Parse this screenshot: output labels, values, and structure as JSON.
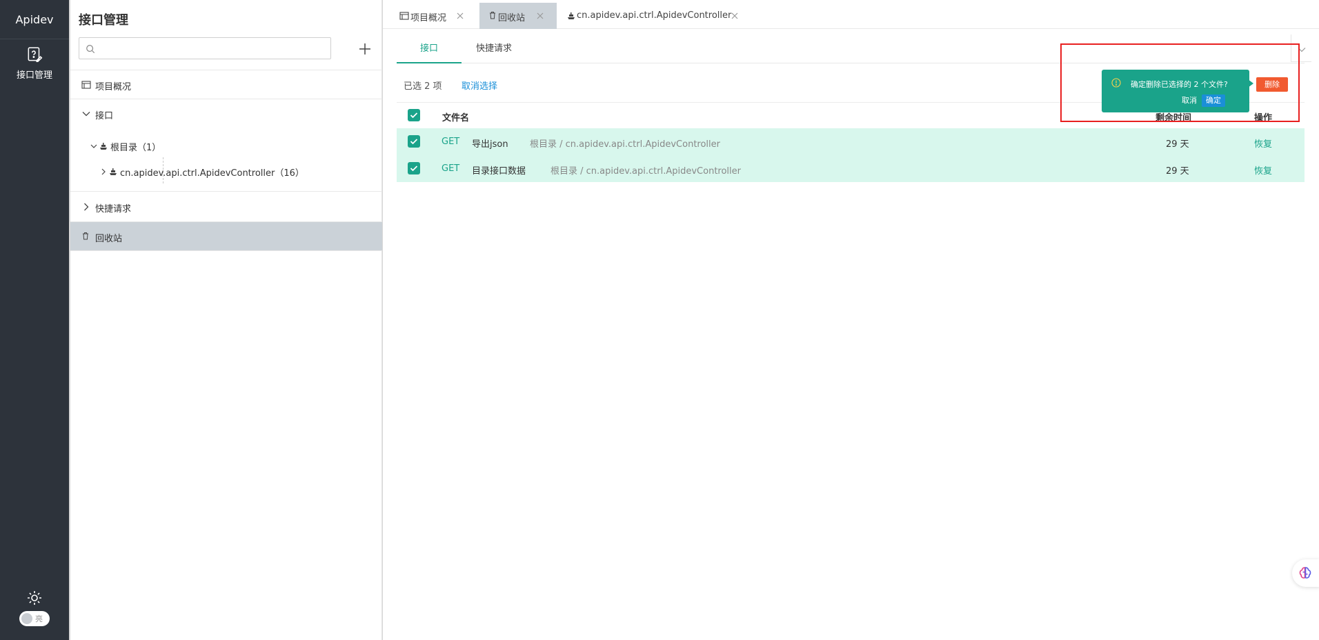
{
  "app": {
    "brand": "Apidev",
    "nav_label": "接口管理",
    "theme_toggle_label": "亮"
  },
  "tree": {
    "title": "接口管理",
    "search_placeholder": "",
    "items": [
      {
        "label": "项目概况"
      },
      {
        "label": "接口"
      },
      {
        "label": "快捷请求"
      },
      {
        "label": "回收站"
      }
    ],
    "folders": {
      "root": "根目录（1）",
      "controller": "cn.apidev.api.ctrl.ApidevController（16）"
    }
  },
  "tabs": [
    {
      "label": "项目概况"
    },
    {
      "label": "回收站"
    },
    {
      "label": "cn.apidev.api.ctrl.ApidevController"
    }
  ],
  "subtabs": [
    {
      "label": "接口"
    },
    {
      "label": "快捷请求"
    }
  ],
  "selection": {
    "info": "已选 2 项",
    "cancel": "取消选择"
  },
  "table": {
    "headers": {
      "name": "文件名",
      "remaining": "剩余时间",
      "action": "操作"
    },
    "rows": [
      {
        "method": "GET",
        "name": "导出json",
        "path": "根目录 / cn.apidev.api.ctrl.ApidevController",
        "days": "29 天",
        "action": "恢复"
      },
      {
        "method": "GET",
        "name": "目录接口数据",
        "path": "根目录 / cn.apidev.api.ctrl.ApidevController",
        "days": "29 天",
        "action": "恢复"
      }
    ]
  },
  "delete_button": "删除",
  "confirm": {
    "message": "确定删除已选择的 2 个文件?",
    "cancel": "取消",
    "ok": "确定"
  },
  "colors": {
    "accent": "#1aa38a",
    "danger": "#f15a30",
    "link": "#1a8fd8",
    "sidebar": "#2d333b",
    "highlight_box": "#e81f1f"
  }
}
